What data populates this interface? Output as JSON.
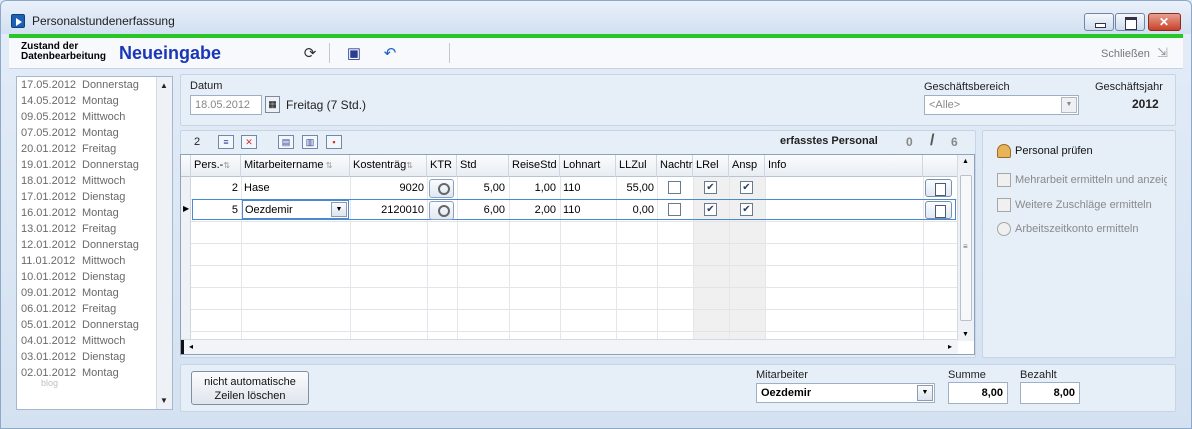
{
  "window": {
    "title": "Personalstundenerfassung"
  },
  "toolbar": {
    "state_label": "Zustand der Datenbearbeitung",
    "state_value": "Neueingabe",
    "close_label": "Schließen"
  },
  "dates": [
    {
      "date": "17.05.2012",
      "day": "Donnerstag"
    },
    {
      "date": "14.05.2012",
      "day": "Montag"
    },
    {
      "date": "09.05.2012",
      "day": "Mittwoch"
    },
    {
      "date": "07.05.2012",
      "day": "Montag"
    },
    {
      "date": "20.01.2012",
      "day": "Freitag"
    },
    {
      "date": "19.01.2012",
      "day": "Donnerstag"
    },
    {
      "date": "18.01.2012",
      "day": "Mittwoch"
    },
    {
      "date": "17.01.2012",
      "day": "Dienstag"
    },
    {
      "date": "16.01.2012",
      "day": "Montag"
    },
    {
      "date": "13.01.2012",
      "day": "Freitag"
    },
    {
      "date": "12.01.2012",
      "day": "Donnerstag"
    },
    {
      "date": "11.01.2012",
      "day": "Mittwoch"
    },
    {
      "date": "10.01.2012",
      "day": "Dienstag"
    },
    {
      "date": "09.01.2012",
      "day": "Montag"
    },
    {
      "date": "06.01.2012",
      "day": "Freitag"
    },
    {
      "date": "05.01.2012",
      "day": "Donnerstag"
    },
    {
      "date": "04.01.2012",
      "day": "Mittwoch"
    },
    {
      "date": "03.01.2012",
      "day": "Dienstag"
    },
    {
      "date": "02.01.2012",
      "day": "Montag"
    }
  ],
  "list_watermark": "blog",
  "header": {
    "datum_label": "Datum",
    "datum_value": "18.05.2012",
    "datum_day": "Freitag (7 Std.)",
    "bereich_label": "Geschäftsbereich",
    "bereich_value": "<Alle>",
    "jahr_label": "Geschäftsjahr",
    "jahr_value": "2012"
  },
  "grid_toolbar": {
    "count": "2",
    "personal_label": "erfasstes Personal",
    "personal_done": "0",
    "personal_sep": "/",
    "personal_total": "6"
  },
  "grid": {
    "columns": [
      "Pers.-",
      "Mitarbeitername",
      "Kostenträg",
      "KTR",
      "Std",
      "ReiseStd",
      "Lohnart",
      "LLZul",
      "Nachtr",
      "LRel",
      "Ansp",
      "Info"
    ],
    "rows": [
      {
        "pers": "2",
        "name": "Hase",
        "kostentraeger": "9020",
        "std": "5,00",
        "reise": "1,00",
        "lohnart": "110",
        "llzul": "55,00",
        "nachtr": false,
        "lrel": true,
        "ansp": true,
        "info": ""
      },
      {
        "pers": "5",
        "name": "Oezdemir",
        "kostentraeger": "2120010",
        "std": "6,00",
        "reise": "2,00",
        "lohnart": "110",
        "llzul": "0,00",
        "nachtr": false,
        "lrel": true,
        "ansp": true,
        "info": ""
      }
    ]
  },
  "actions": {
    "pruefen": "Personal prüfen",
    "mehrarbeit": "Mehrarbeit ermitteln und anzeigen",
    "zuschlaege": "Weitere Zuschläge ermitteln",
    "arbeitszeit": "Arbeitszeitkonto ermitteln"
  },
  "footer": {
    "button_line1": "nicht automatische",
    "button_line2": "Zeilen löschen",
    "mitarbeiter_label": "Mitarbeiter",
    "mitarbeiter_value": "Oezdemir",
    "summe_label": "Summe",
    "summe_value": "8,00",
    "bezahlt_label": "Bezahlt",
    "bezahlt_value": "8,00"
  }
}
